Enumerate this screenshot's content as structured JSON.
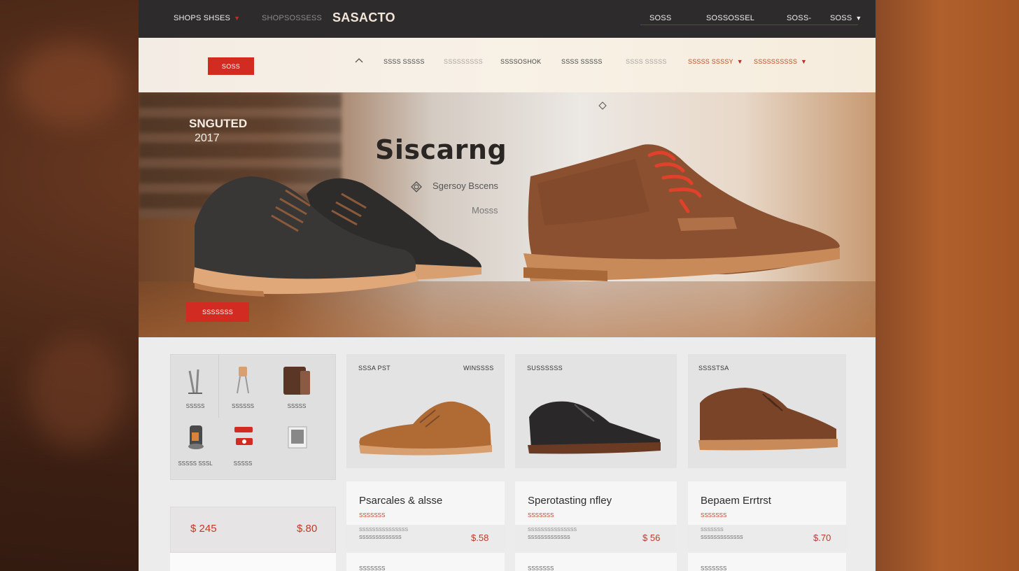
{
  "header": {
    "shop_menu": "SHOPS SHSES",
    "secondary_link": "SHOPSOSSESS",
    "brand": "SASACTO",
    "links": [
      "SOSS",
      "SOSSOSSEL",
      "SOSS-",
      "SOSS"
    ]
  },
  "navbar": {
    "cta_label": "SOSS",
    "items": [
      {
        "label": "SSSS SSSSS"
      },
      {
        "label": "SSSSSSSSS"
      },
      {
        "label": "SSSSOSHOK"
      },
      {
        "label": "SSSS SSSSS"
      },
      {
        "label": "SSSS SSSSS"
      },
      {
        "label": "SSSSS SSSSY"
      },
      {
        "label": "SSSSSSSSSS"
      }
    ]
  },
  "hero": {
    "tag": "SNGUTED",
    "year": "2017",
    "title": "Siscarng",
    "subtitle": "Sgersoy Bscens",
    "subtitle2": "Mosss",
    "cta_label": "SSSSSSS"
  },
  "categories": [
    {
      "label": "SSSSS"
    },
    {
      "label": "SSSSSS"
    },
    {
      "label": "SSSSS"
    },
    {
      "label": "SSSSS SSSL"
    },
    {
      "label": "SSSSS"
    },
    {
      "label": ""
    }
  ],
  "price_panel": {
    "left": "$ 245",
    "right": "$.80"
  },
  "products": [
    {
      "label_left": "SSSA PST",
      "label_right": "WINSSSS",
      "name": "Psarcales & alsse",
      "sub": "SSSSSSS",
      "meta1": "SSSSSSSSSSSSSSS",
      "meta2": "SSSSSSSSSSSSS",
      "price": "$.58",
      "bottom": "SSSSSSS"
    },
    {
      "label_left": "SUSSSSSS",
      "label_right": "",
      "name": "Sperotasting nfley",
      "sub": "SSSSSSS",
      "meta1": "SSSSSSSSSSSSSSS",
      "meta2": "SSSSSSSSSSSSS",
      "price": "$ 56",
      "bottom": "SSSSSSS"
    },
    {
      "label_left": "SSSSTSA",
      "label_right": "",
      "name": "Bepaem Errtrst",
      "sub": "SSSSSSS",
      "meta1": "SSSSSSS",
      "meta2": "SSSSSSSSSSSSS",
      "price": "$.70",
      "bottom": "SSSSSSS"
    }
  ],
  "colors": {
    "accent": "#d22b22",
    "dark": "#2d2b2c",
    "price": "#c0392b"
  }
}
